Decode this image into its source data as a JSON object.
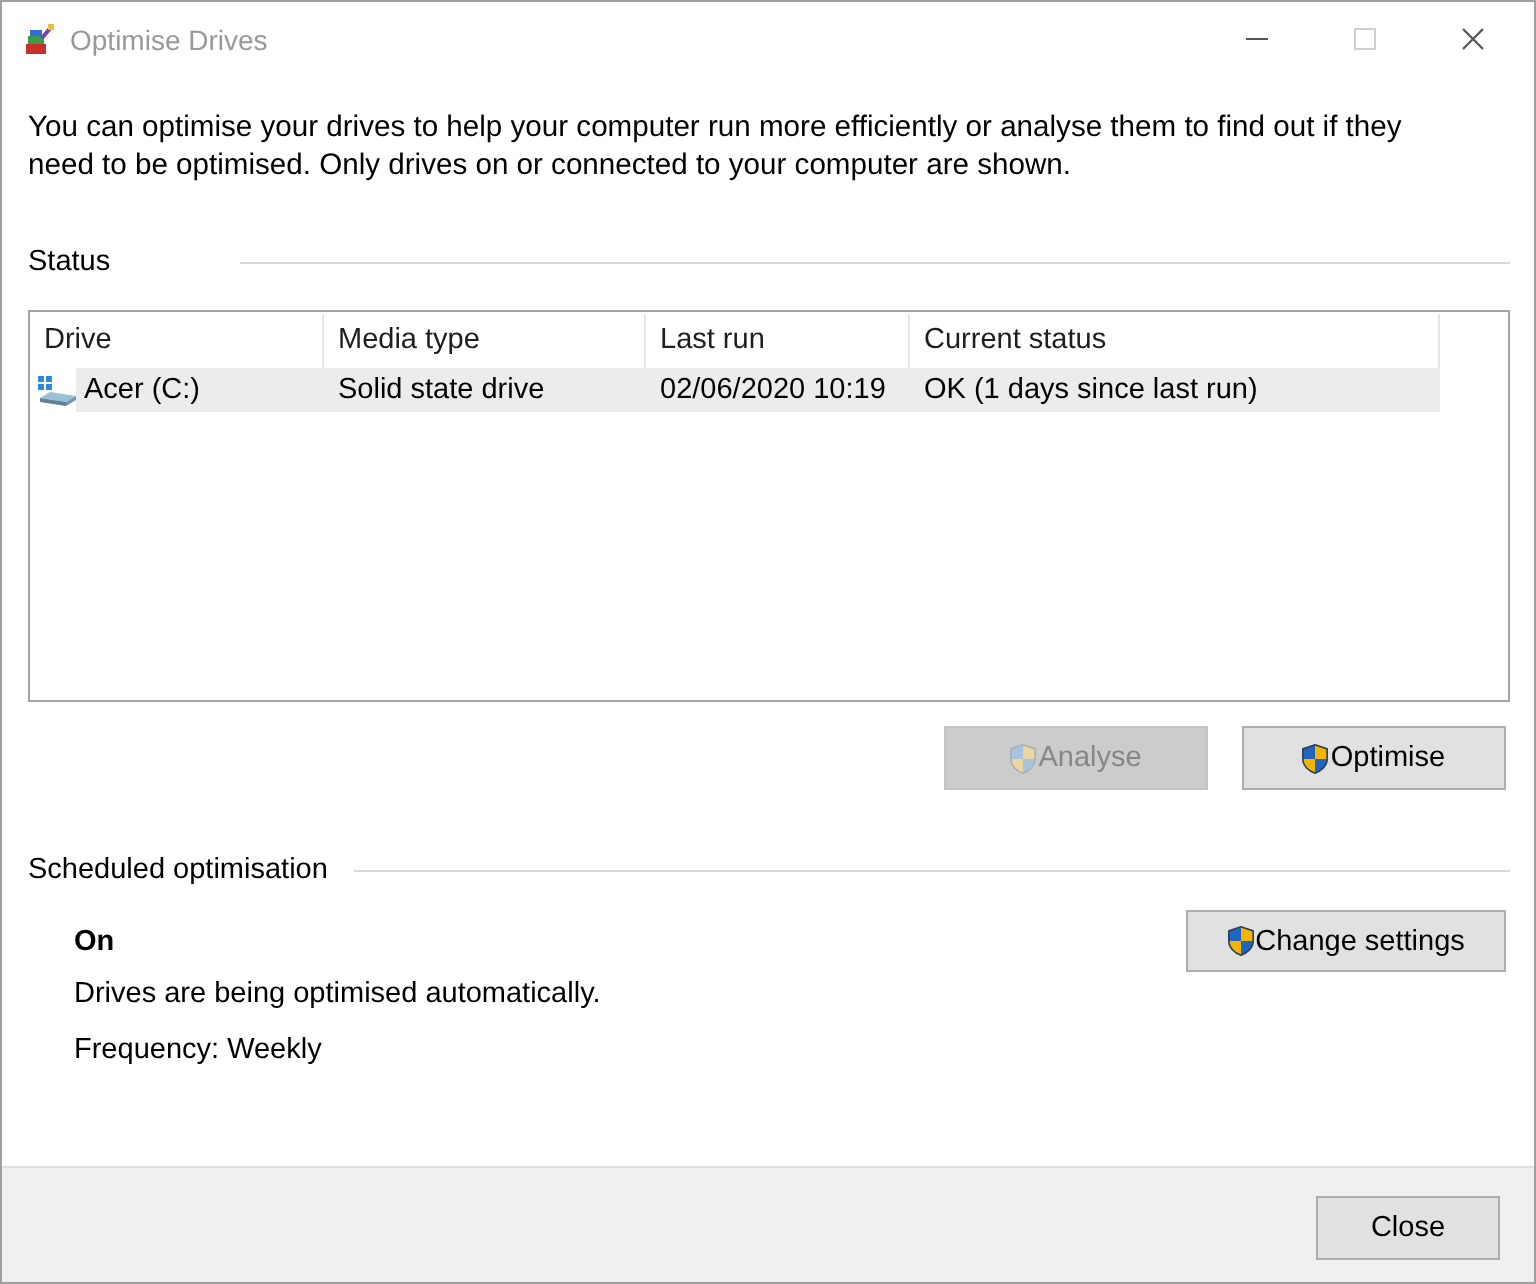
{
  "window": {
    "title": "Optimise Drives",
    "active": false,
    "controls": [
      {
        "kind": "minimize",
        "disabled": false
      },
      {
        "kind": "maximize",
        "disabled": true
      },
      {
        "kind": "close",
        "disabled": false
      }
    ]
  },
  "description": "You can optimise your drives to help your computer run more efficiently or analyse them to find out if they need to be optimised. Only drives on or connected to your computer are shown.",
  "status": {
    "heading": "Status",
    "table": {
      "columns": [
        "Drive",
        "Media type",
        "Last run",
        "Current status"
      ],
      "rows": [
        {
          "selected": true,
          "cells": [
            "Acer (C:)",
            "Solid state drive",
            "02/06/2020 10:19",
            "OK (1 days since last run)"
          ]
        }
      ]
    },
    "buttons": [
      {
        "label": "Analyse",
        "shield": true,
        "disabled": true
      },
      {
        "label": "Optimise",
        "shield": true,
        "disabled": false
      }
    ]
  },
  "scheduled_optimisation": {
    "heading": "Scheduled optimisation",
    "state": "On",
    "message": "Drives are being optimised automatically.",
    "frequency": "Frequency: Weekly",
    "button": {
      "label": "Change settings",
      "shield": true,
      "disabled": false
    }
  },
  "footer": {
    "buttons": [
      {
        "label": "Close",
        "shield": false,
        "disabled": false
      }
    ]
  }
}
